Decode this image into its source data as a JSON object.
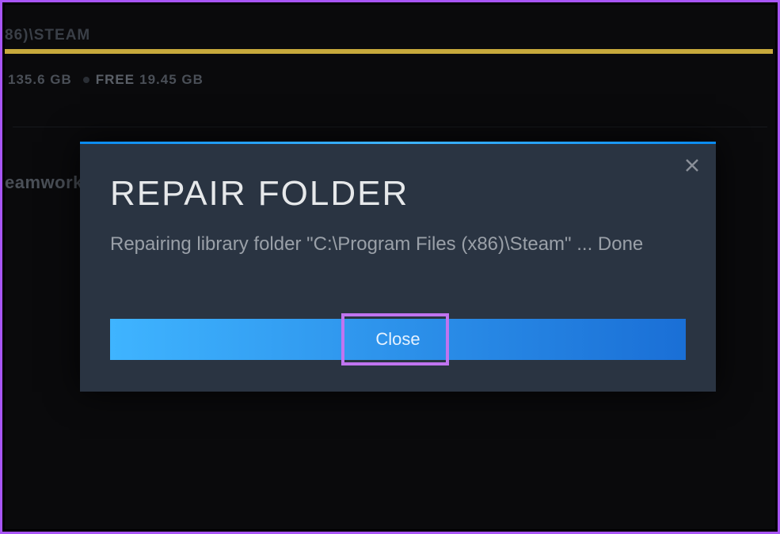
{
  "background": {
    "path_fragment": "86)\\STEAM",
    "used_size": "135.6 GB",
    "free_label": "FREE",
    "free_size": "19.45 GB",
    "side_text_fragment": "eamwork"
  },
  "dialog": {
    "title": "REPAIR FOLDER",
    "message": "Repairing library folder \"C:\\Program Files (x86)\\Steam\" ... Done",
    "close_button_label": "Close"
  }
}
